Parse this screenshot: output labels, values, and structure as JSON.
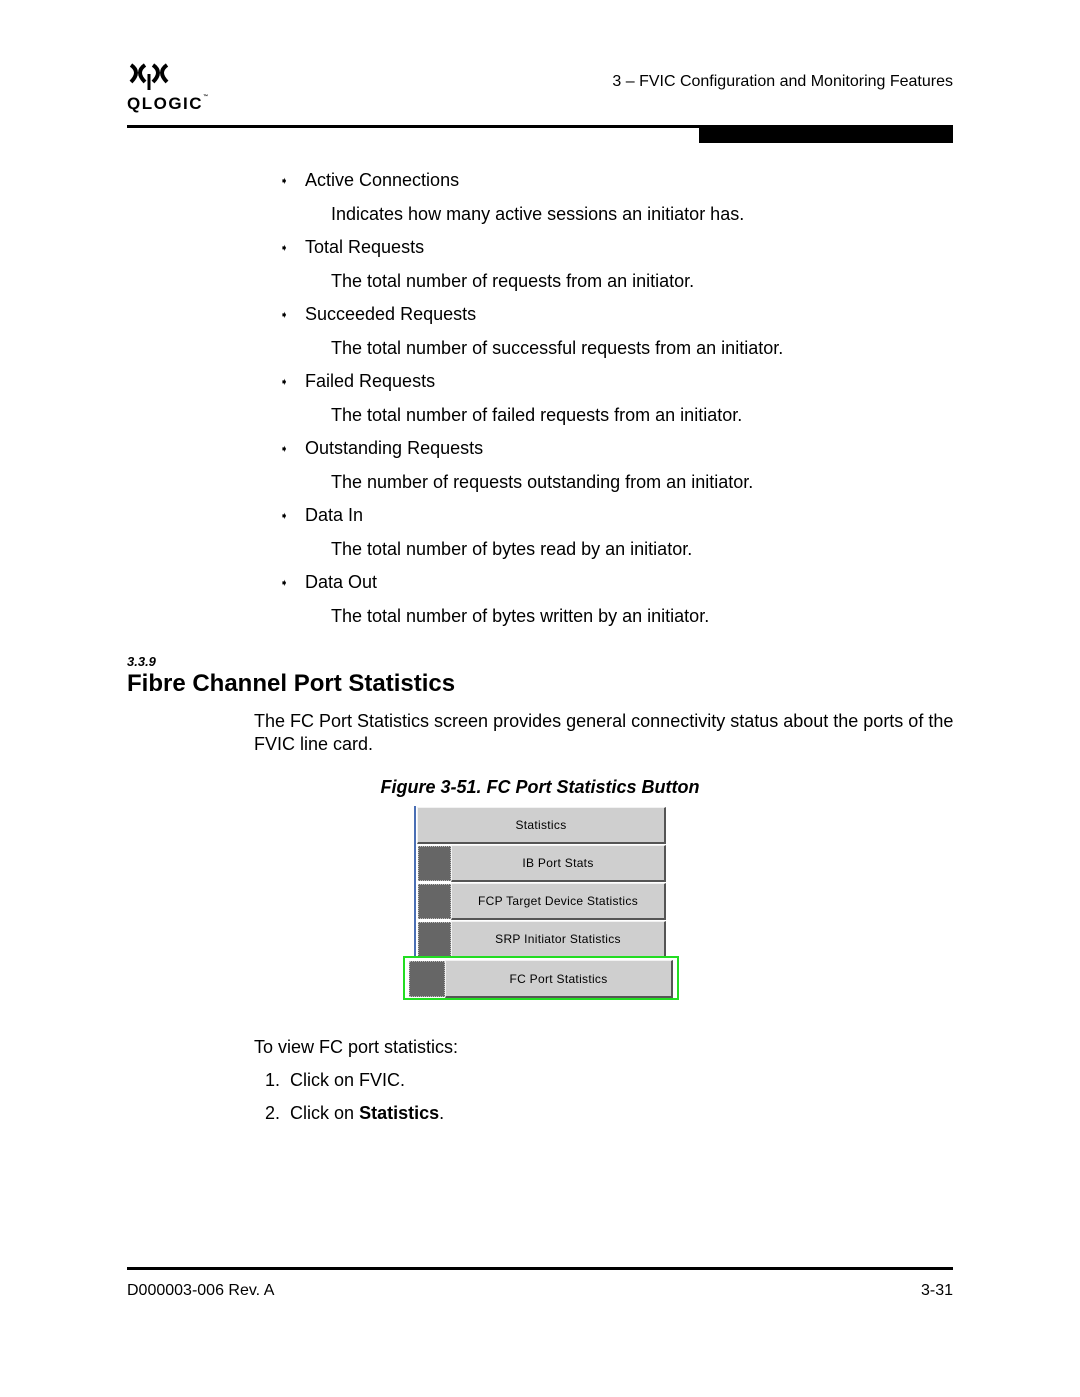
{
  "header": {
    "logo_text": "QLOGIC",
    "logo_tm": "™",
    "chapter_title": "3 – FVIC Configuration and Monitoring Features"
  },
  "bullets": [
    {
      "term": "Active Connections",
      "desc": "Indicates how many active sessions an initiator has."
    },
    {
      "term": "Total Requests",
      "desc": "The total number of requests from an initiator."
    },
    {
      "term": "Succeeded Requests",
      "desc": "The total number of successful requests from an initiator."
    },
    {
      "term": "Failed Requests",
      "desc": "The total number of failed requests from an initiator."
    },
    {
      "term": "Outstanding Requests",
      "desc": "The number of requests outstanding from an initiator."
    },
    {
      "term": "Data In",
      "desc": "The total number of bytes read by an initiator."
    },
    {
      "term": "Data Out",
      "desc": "The total number of bytes written by an initiator."
    }
  ],
  "bullet_icon": "arrow-bullet-icon",
  "section": {
    "number": "3.3.9",
    "title": "Fibre Channel Port Statistics",
    "paragraph": "The FC Port Statistics screen provides general connectivity status about the ports of the FVIC line card."
  },
  "figure": {
    "caption": "Figure 3-51. FC Port Statistics Button",
    "buttons": {
      "statistics": "Statistics",
      "ib_port_stats": "IB Port Stats",
      "fcp_target": "FCP Target Device Statistics",
      "srp_initiator": "SRP Initiator Statistics",
      "fc_port": "FC Port Statistics"
    },
    "highlight_color": "#22dd22"
  },
  "steps": {
    "intro": "To view FC port statistics:",
    "items": [
      {
        "num": "1.",
        "text": "Click on FVIC.",
        "bold": ""
      },
      {
        "num": "2.",
        "text": "Click on ",
        "bold": "Statistics",
        "tail": "."
      }
    ]
  },
  "footer": {
    "doc_id": "D000003-006 Rev. A",
    "page": "3-31"
  }
}
